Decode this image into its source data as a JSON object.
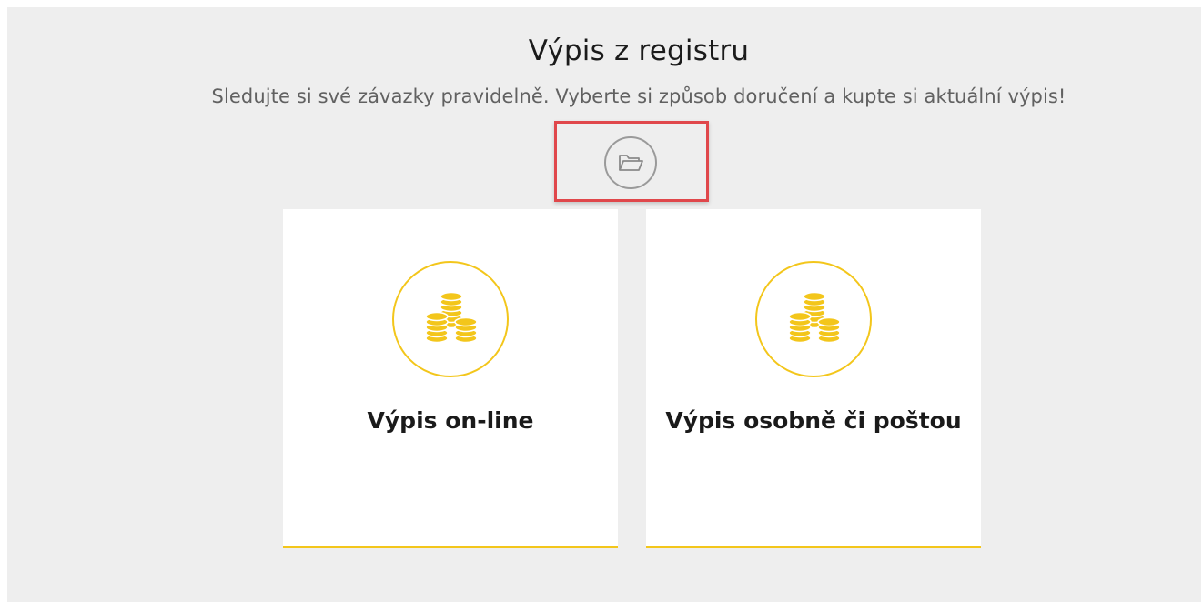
{
  "header": {
    "title": "Výpis z registru",
    "subtitle": "Sledujte si své závazky pravidelně. Vyberte si způsob doručení a kupte si aktuální výpis!"
  },
  "folder_button": {
    "icon": "folder-open-icon"
  },
  "options": [
    {
      "label": "Výpis on-line",
      "icon": "coins-icon"
    },
    {
      "label": "Výpis osobně či poštou",
      "icon": "coins-icon"
    }
  ],
  "colors": {
    "accent": "#f3c61b",
    "highlight": "#e0474b",
    "background": "#eeeeee"
  }
}
